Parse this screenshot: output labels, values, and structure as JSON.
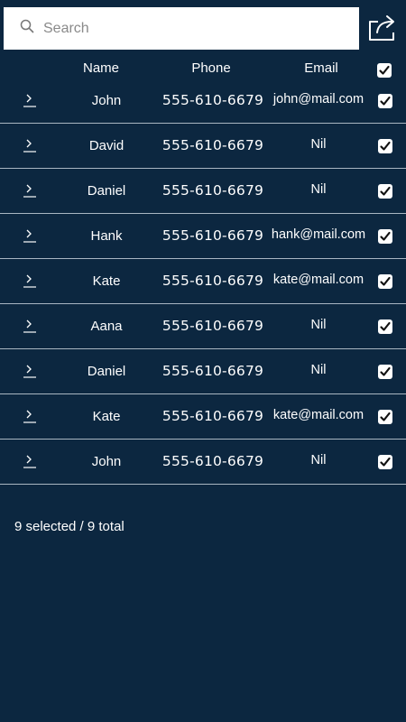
{
  "search": {
    "placeholder": "Search",
    "value": ""
  },
  "header": {
    "name_label": "Name",
    "phone_label": "Phone",
    "email_label": "Email",
    "select_all_checked": true
  },
  "contacts": [
    {
      "name": "John",
      "phone": "555-610-6679",
      "email": "john@mail.com",
      "checked": true
    },
    {
      "name": "David",
      "phone": "555-610-6679",
      "email": "Nil",
      "checked": true
    },
    {
      "name": "Daniel",
      "phone": "555-610-6679",
      "email": "Nil",
      "checked": true
    },
    {
      "name": "Hank",
      "phone": "555-610-6679",
      "email": "hank@mail.com",
      "checked": true
    },
    {
      "name": "Kate",
      "phone": "555-610-6679",
      "email": "kate@mail.com",
      "checked": true
    },
    {
      "name": "Aana",
      "phone": "555-610-6679",
      "email": "Nil",
      "checked": true
    },
    {
      "name": "Daniel",
      "phone": "555-610-6679",
      "email": "Nil",
      "checked": true
    },
    {
      "name": "Kate",
      "phone": "555-610-6679",
      "email": "kate@mail.com",
      "checked": true
    },
    {
      "name": "John",
      "phone": "555-610-6679",
      "email": "Nil",
      "checked": true
    }
  ],
  "status": {
    "text": "9 selected / 9 total"
  },
  "icons": {
    "search": "search-icon",
    "share": "share-icon",
    "expand": "chevron-right-icon",
    "check": "checkmark-icon"
  },
  "colors": {
    "background": "#0c2740",
    "divider": "#a9b6c2"
  }
}
